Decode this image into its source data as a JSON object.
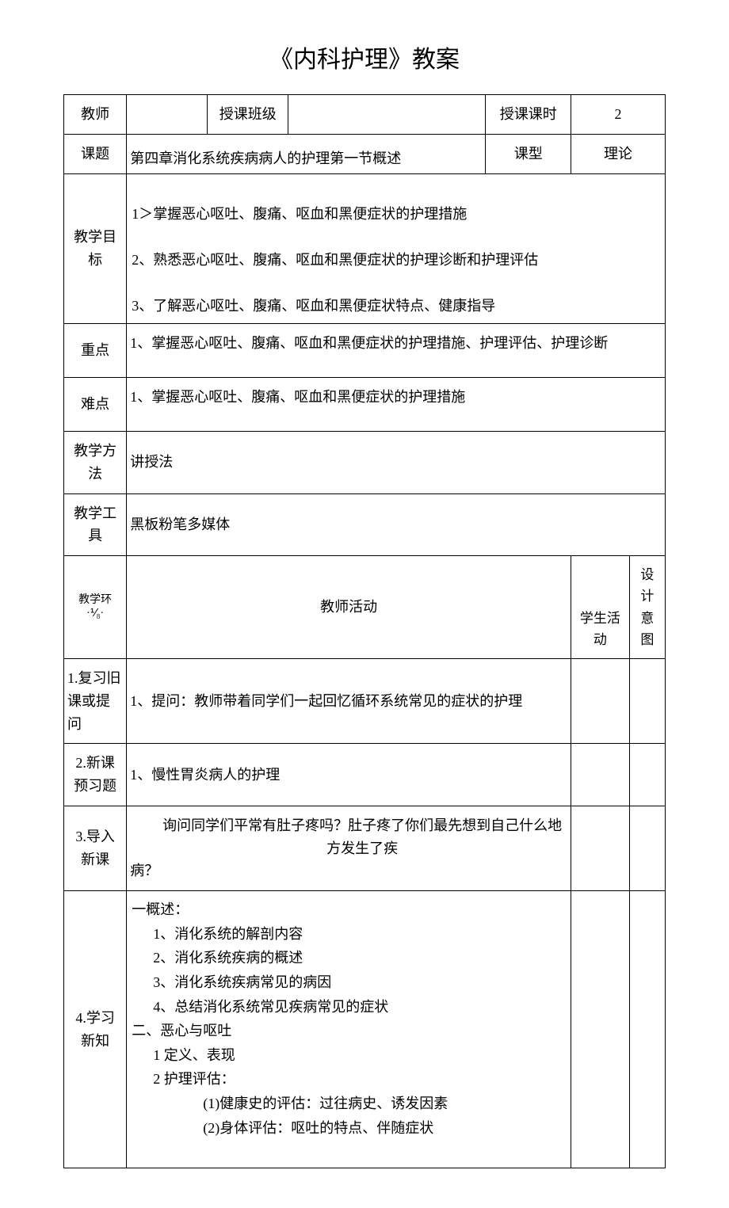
{
  "title": "《内科护理》教案",
  "row1": {
    "teacher_label": "教师",
    "teacher_value": "",
    "class_label": "授课班级",
    "class_value": "",
    "hours_label": "授课课时",
    "hours_value": "2"
  },
  "row_topic": {
    "topic_label": "课题",
    "topic_value": "第四章消化系统疾病病人的护理第一节概述",
    "type_label": "课型",
    "type_value": "理论"
  },
  "row_goals": {
    "label": "教学目标",
    "lines": [
      "1＞掌握恶心呕吐、腹痛、呕血和黑便症状的护理措施",
      "2、熟悉恶心呕吐、腹痛、呕血和黑便症状的护理诊断和护理评估",
      "3、了解恶心呕吐、腹痛、呕血和黑便症状特点、健康指导"
    ]
  },
  "row_keypoint": {
    "label": "重点",
    "value": "1、掌握恶心呕吐、腹痛、呕血和黑便症状的护理措施、护理评估、护理诊断"
  },
  "row_difficulty": {
    "label": "难点",
    "value": "1、掌握恶心呕吐、腹痛、呕血和黑便症状的护理措施"
  },
  "row_method": {
    "label": "教学方法",
    "value": "讲授法"
  },
  "row_tools": {
    "label": "教学工具",
    "value": " 黑板粉笔多媒体"
  },
  "row_header2": {
    "col1_line1": "教学环",
    "col1_line2": "·⅟₈·",
    "teacher_activity": "教师活动",
    "student_activity": "学生活动",
    "design_intent": "设计意图"
  },
  "section1": {
    "label": "1.复习旧课或提问",
    "content": "1、提问：教师带着同学们一起回忆循环系统常见的症状的护理"
  },
  "section2": {
    "label": "2.新课预习题",
    "content": "1、慢性胃炎病人的护理"
  },
  "section3": {
    "label": "3.导入新课",
    "line1": "询问同学们平常有肚子疼吗？肚子疼了你们最先想到自己什么地方发生了疾",
    "line2": "病？"
  },
  "section4": {
    "label": "4.学习新知",
    "lines": [
      {
        "indent": "i1",
        "text": "一概述："
      },
      {
        "indent": "i2",
        "text": "1、消化系统的解剖内容"
      },
      {
        "indent": "i2",
        "text": "2、消化系统疾病的概述"
      },
      {
        "indent": "i2",
        "text": "3、消化系统疾病常见的病因"
      },
      {
        "indent": "i2",
        "text": "4、总结消化系统常见疾病常见的症状"
      },
      {
        "indent": "i1",
        "text": "二、恶心与呕吐"
      },
      {
        "indent": "i2",
        "text": "1 定义、表现"
      },
      {
        "indent": "i2",
        "text": "2 护理评估："
      },
      {
        "indent": "i3",
        "text": "(1)健康史的评估：过往病史、诱发因素"
      },
      {
        "indent": "i3",
        "text": "(2)身体评估：呕吐的特点、伴随症状"
      }
    ]
  }
}
